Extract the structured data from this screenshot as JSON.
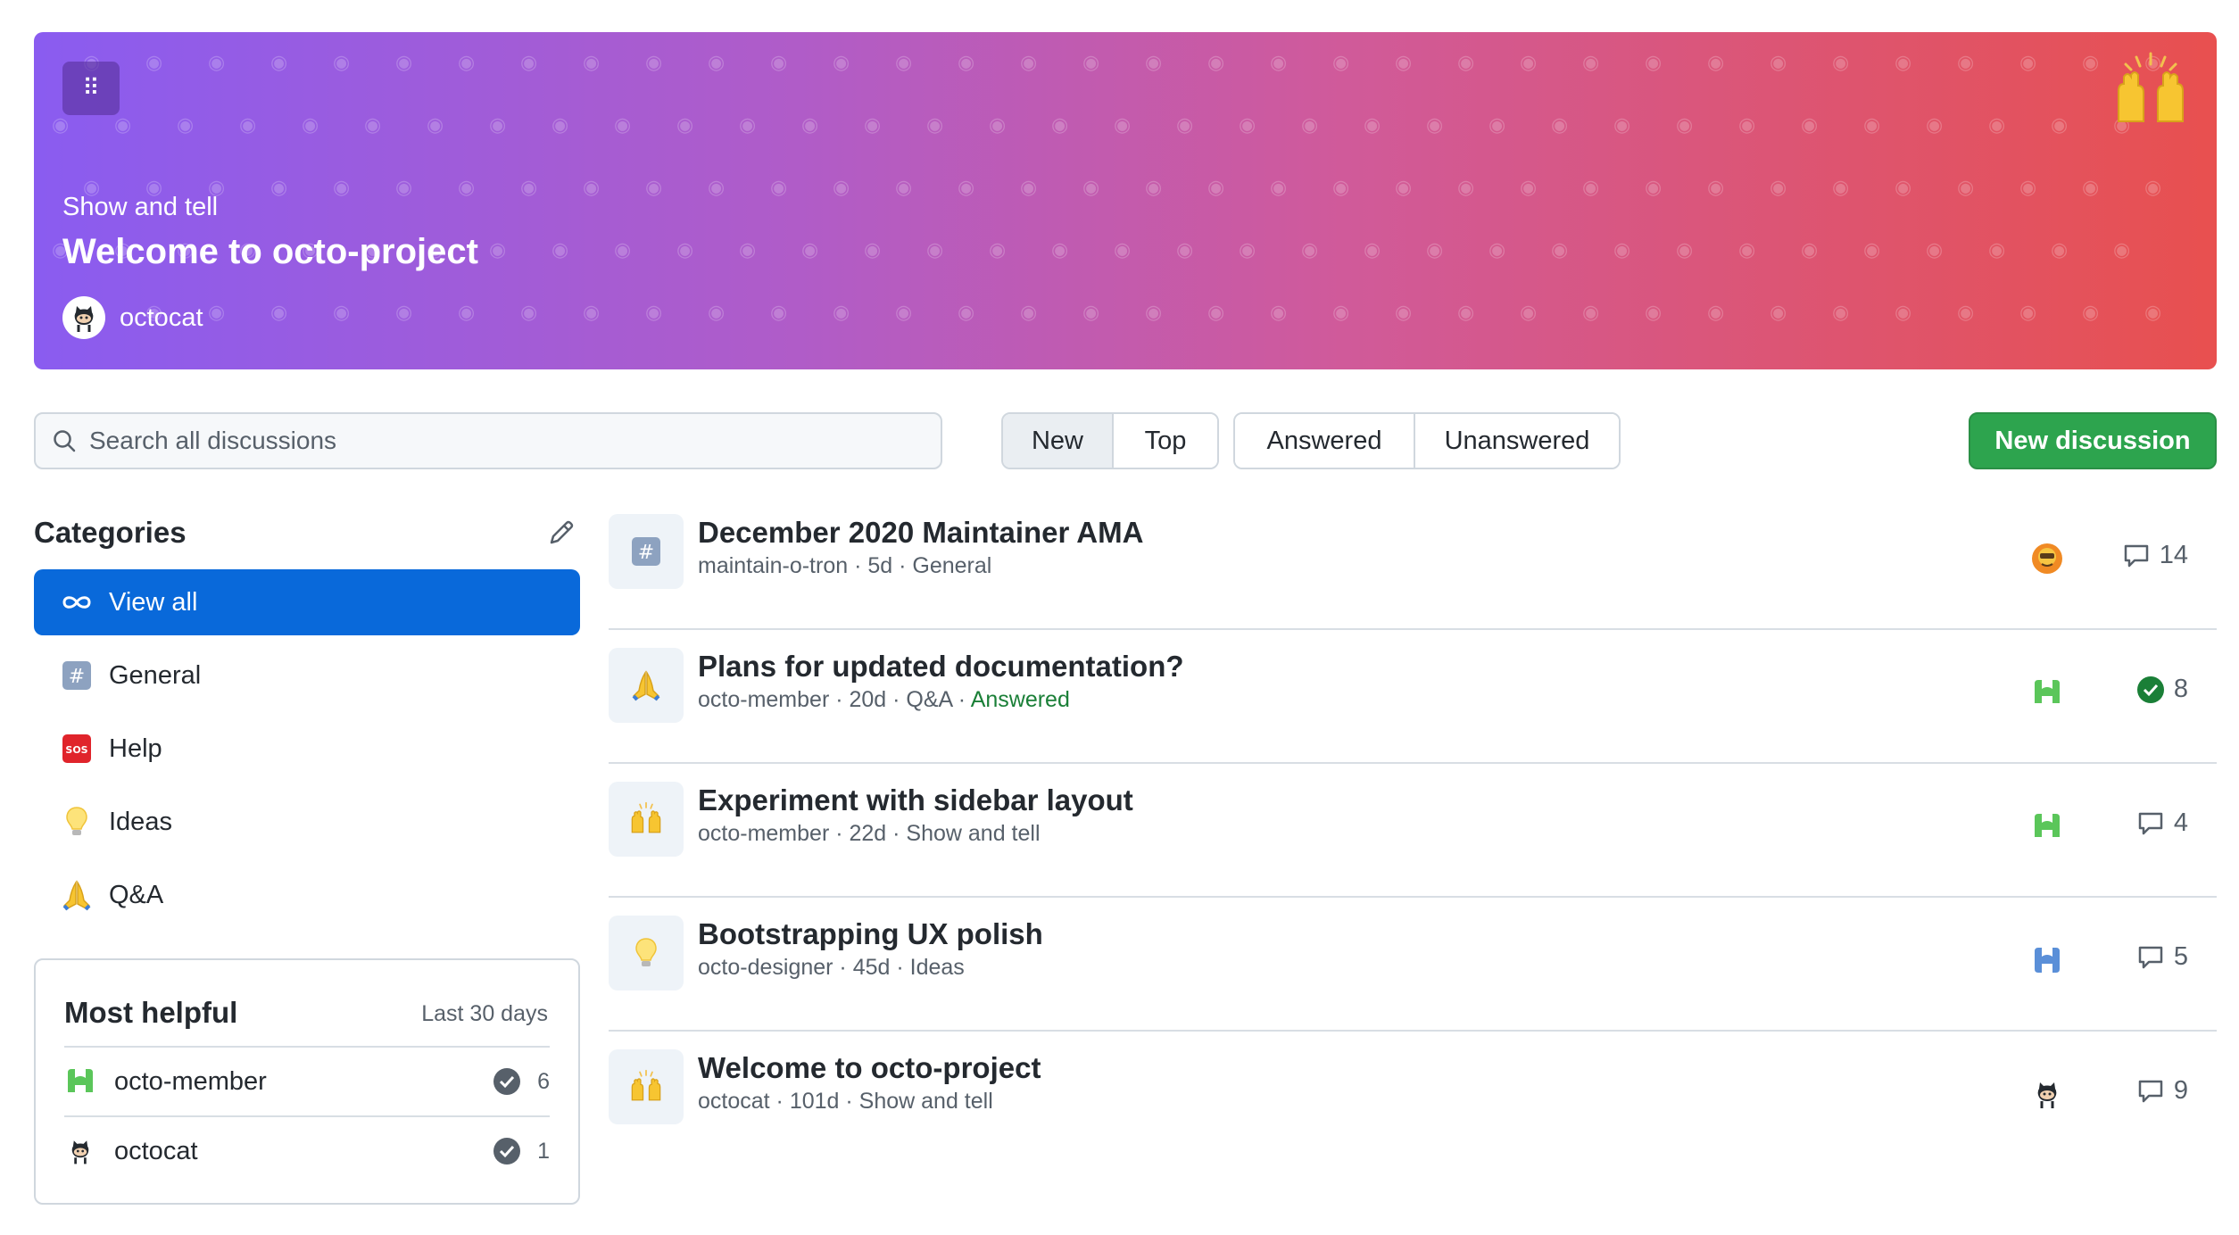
{
  "banner": {
    "category": "Show and tell",
    "title": "Welcome to octo-project",
    "author": "octocat",
    "drag_icon": "grabber-icon",
    "emoji": "raised-hands",
    "pattern_icon": "cat-face-icon",
    "gradient": [
      "#8a5cf0",
      "#e8504f"
    ]
  },
  "search": {
    "placeholder": "Search all discussions"
  },
  "sort_tabs": [
    {
      "label": "New",
      "active": true
    },
    {
      "label": "Top",
      "active": false
    }
  ],
  "status_tabs": [
    {
      "label": "Answered"
    },
    {
      "label": "Unanswered"
    }
  ],
  "new_discussion_label": "New discussion",
  "categories": {
    "title": "Categories",
    "items": [
      {
        "label": "View all",
        "icon": "infinity-icon",
        "active": true
      },
      {
        "label": "General",
        "icon": "hash-icon"
      },
      {
        "label": "Help",
        "icon": "sos-icon"
      },
      {
        "label": "Ideas",
        "icon": "bulb-icon"
      },
      {
        "label": "Q&A",
        "icon": "pray-icon"
      }
    ]
  },
  "most_helpful": {
    "title": "Most helpful",
    "range": "Last 30 days",
    "users": [
      {
        "name": "octo-member",
        "count": "6"
      },
      {
        "name": "octocat",
        "count": "1"
      }
    ]
  },
  "discussions": [
    {
      "title": "December 2020 Maintainer AMA",
      "author": "maintain-o-tron",
      "age": "5d",
      "category": "General",
      "status": "",
      "comments": "14",
      "icon": "hash-icon",
      "answered": false
    },
    {
      "title": "Plans for updated documentation?",
      "author": "octo-member",
      "age": "20d",
      "category": "Q&A",
      "status": "Answered",
      "comments": "8",
      "icon": "pray-icon",
      "answered": true
    },
    {
      "title": "Experiment with sidebar layout",
      "author": "octo-member",
      "age": "22d",
      "category": "Show and tell",
      "status": "",
      "comments": "4",
      "icon": "raised-hands-icon",
      "answered": false
    },
    {
      "title": "Bootstrapping UX polish",
      "author": "octo-designer",
      "age": "45d",
      "category": "Ideas",
      "status": "",
      "comments": "5",
      "icon": "bulb-icon",
      "answered": false
    },
    {
      "title": "Welcome to octo-project",
      "author": "octocat",
      "age": "101d",
      "category": "Show and tell",
      "status": "",
      "comments": "9",
      "icon": "raised-hands-icon",
      "answered": false
    }
  ],
  "colors": {
    "accent": "#0969da",
    "primary_button": "#2da44e",
    "answered": "#1a7f37"
  }
}
